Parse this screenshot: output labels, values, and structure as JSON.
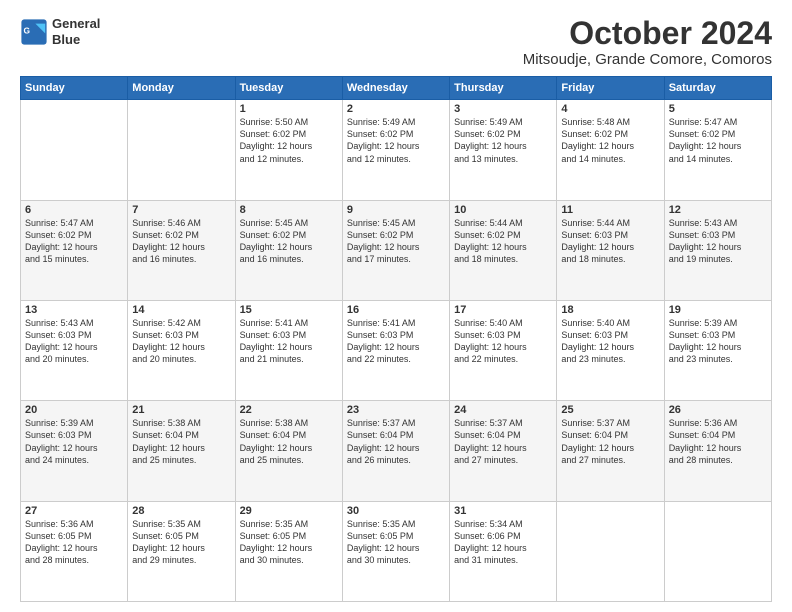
{
  "header": {
    "logo_line1": "General",
    "logo_line2": "Blue",
    "month": "October 2024",
    "location": "Mitsoudje, Grande Comore, Comoros"
  },
  "days_of_week": [
    "Sunday",
    "Monday",
    "Tuesday",
    "Wednesday",
    "Thursday",
    "Friday",
    "Saturday"
  ],
  "weeks": [
    [
      {
        "day": "",
        "info": ""
      },
      {
        "day": "",
        "info": ""
      },
      {
        "day": "1",
        "info": "Sunrise: 5:50 AM\nSunset: 6:02 PM\nDaylight: 12 hours\nand 12 minutes."
      },
      {
        "day": "2",
        "info": "Sunrise: 5:49 AM\nSunset: 6:02 PM\nDaylight: 12 hours\nand 12 minutes."
      },
      {
        "day": "3",
        "info": "Sunrise: 5:49 AM\nSunset: 6:02 PM\nDaylight: 12 hours\nand 13 minutes."
      },
      {
        "day": "4",
        "info": "Sunrise: 5:48 AM\nSunset: 6:02 PM\nDaylight: 12 hours\nand 14 minutes."
      },
      {
        "day": "5",
        "info": "Sunrise: 5:47 AM\nSunset: 6:02 PM\nDaylight: 12 hours\nand 14 minutes."
      }
    ],
    [
      {
        "day": "6",
        "info": "Sunrise: 5:47 AM\nSunset: 6:02 PM\nDaylight: 12 hours\nand 15 minutes."
      },
      {
        "day": "7",
        "info": "Sunrise: 5:46 AM\nSunset: 6:02 PM\nDaylight: 12 hours\nand 16 minutes."
      },
      {
        "day": "8",
        "info": "Sunrise: 5:45 AM\nSunset: 6:02 PM\nDaylight: 12 hours\nand 16 minutes."
      },
      {
        "day": "9",
        "info": "Sunrise: 5:45 AM\nSunset: 6:02 PM\nDaylight: 12 hours\nand 17 minutes."
      },
      {
        "day": "10",
        "info": "Sunrise: 5:44 AM\nSunset: 6:02 PM\nDaylight: 12 hours\nand 18 minutes."
      },
      {
        "day": "11",
        "info": "Sunrise: 5:44 AM\nSunset: 6:03 PM\nDaylight: 12 hours\nand 18 minutes."
      },
      {
        "day": "12",
        "info": "Sunrise: 5:43 AM\nSunset: 6:03 PM\nDaylight: 12 hours\nand 19 minutes."
      }
    ],
    [
      {
        "day": "13",
        "info": "Sunrise: 5:43 AM\nSunset: 6:03 PM\nDaylight: 12 hours\nand 20 minutes."
      },
      {
        "day": "14",
        "info": "Sunrise: 5:42 AM\nSunset: 6:03 PM\nDaylight: 12 hours\nand 20 minutes."
      },
      {
        "day": "15",
        "info": "Sunrise: 5:41 AM\nSunset: 6:03 PM\nDaylight: 12 hours\nand 21 minutes."
      },
      {
        "day": "16",
        "info": "Sunrise: 5:41 AM\nSunset: 6:03 PM\nDaylight: 12 hours\nand 22 minutes."
      },
      {
        "day": "17",
        "info": "Sunrise: 5:40 AM\nSunset: 6:03 PM\nDaylight: 12 hours\nand 22 minutes."
      },
      {
        "day": "18",
        "info": "Sunrise: 5:40 AM\nSunset: 6:03 PM\nDaylight: 12 hours\nand 23 minutes."
      },
      {
        "day": "19",
        "info": "Sunrise: 5:39 AM\nSunset: 6:03 PM\nDaylight: 12 hours\nand 23 minutes."
      }
    ],
    [
      {
        "day": "20",
        "info": "Sunrise: 5:39 AM\nSunset: 6:03 PM\nDaylight: 12 hours\nand 24 minutes."
      },
      {
        "day": "21",
        "info": "Sunrise: 5:38 AM\nSunset: 6:04 PM\nDaylight: 12 hours\nand 25 minutes."
      },
      {
        "day": "22",
        "info": "Sunrise: 5:38 AM\nSunset: 6:04 PM\nDaylight: 12 hours\nand 25 minutes."
      },
      {
        "day": "23",
        "info": "Sunrise: 5:37 AM\nSunset: 6:04 PM\nDaylight: 12 hours\nand 26 minutes."
      },
      {
        "day": "24",
        "info": "Sunrise: 5:37 AM\nSunset: 6:04 PM\nDaylight: 12 hours\nand 27 minutes."
      },
      {
        "day": "25",
        "info": "Sunrise: 5:37 AM\nSunset: 6:04 PM\nDaylight: 12 hours\nand 27 minutes."
      },
      {
        "day": "26",
        "info": "Sunrise: 5:36 AM\nSunset: 6:04 PM\nDaylight: 12 hours\nand 28 minutes."
      }
    ],
    [
      {
        "day": "27",
        "info": "Sunrise: 5:36 AM\nSunset: 6:05 PM\nDaylight: 12 hours\nand 28 minutes."
      },
      {
        "day": "28",
        "info": "Sunrise: 5:35 AM\nSunset: 6:05 PM\nDaylight: 12 hours\nand 29 minutes."
      },
      {
        "day": "29",
        "info": "Sunrise: 5:35 AM\nSunset: 6:05 PM\nDaylight: 12 hours\nand 30 minutes."
      },
      {
        "day": "30",
        "info": "Sunrise: 5:35 AM\nSunset: 6:05 PM\nDaylight: 12 hours\nand 30 minutes."
      },
      {
        "day": "31",
        "info": "Sunrise: 5:34 AM\nSunset: 6:06 PM\nDaylight: 12 hours\nand 31 minutes."
      },
      {
        "day": "",
        "info": ""
      },
      {
        "day": "",
        "info": ""
      }
    ]
  ]
}
